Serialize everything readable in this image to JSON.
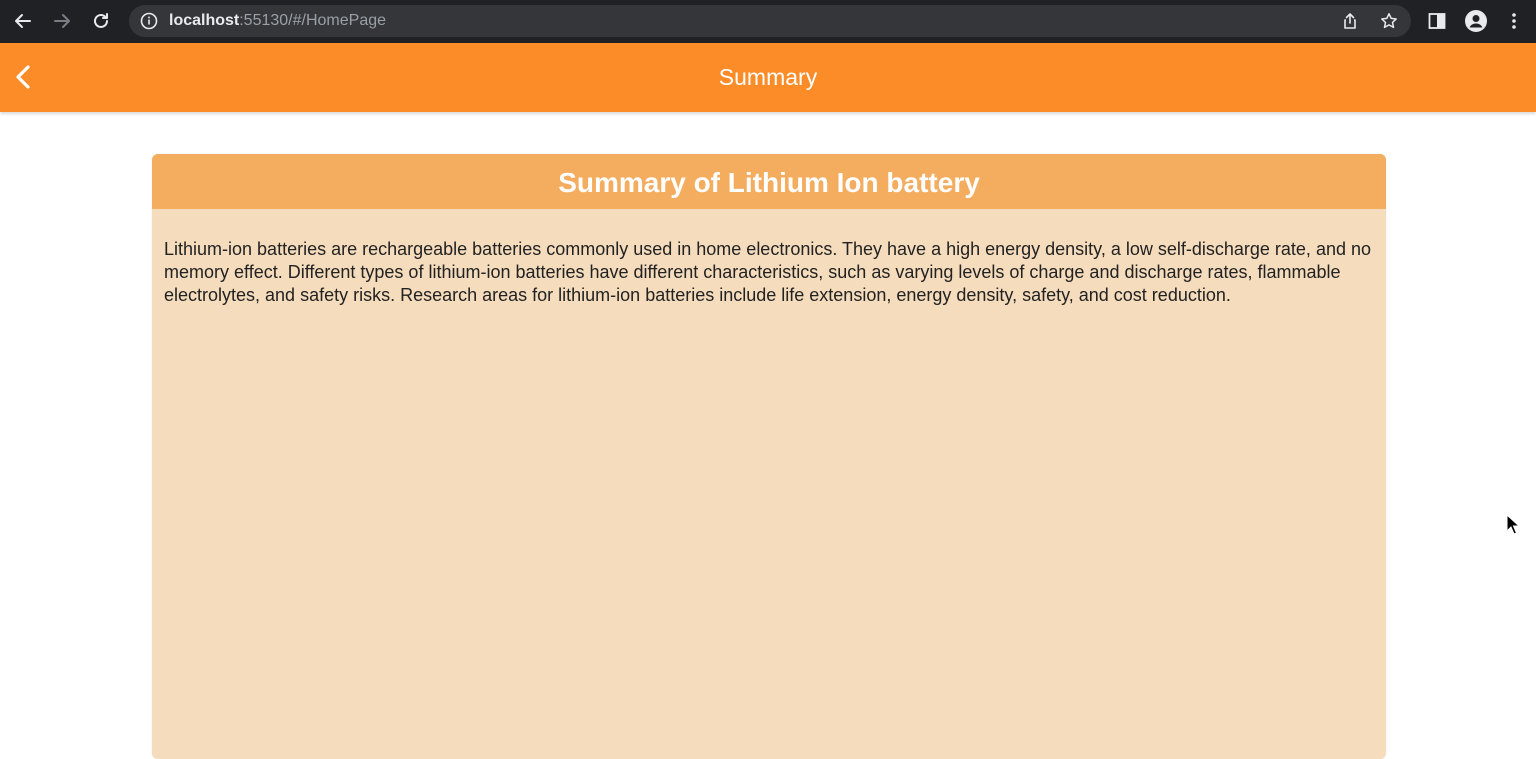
{
  "browser": {
    "url_host": "localhost",
    "url_rest": ":55130/#/HomePage"
  },
  "appbar": {
    "title": "Summary"
  },
  "card": {
    "title": "Summary of Lithium Ion battery",
    "body": " Lithium-ion batteries are rechargeable batteries commonly used in home electronics. They have a high energy density, a low self-discharge rate, and no memory effect. Different types of lithium-ion batteries have different characteristics, such as varying levels of charge and discharge rates, flammable electrolytes, and safety risks. Research areas for lithium-ion batteries include life extension, energy density, safety, and cost reduction."
  },
  "colors": {
    "chrome": "#202124",
    "appbar": "#fb8c28",
    "card_header": "#f4ad5f",
    "card_body": "#f5dcbd"
  },
  "icons": {
    "back": "arrow-left-icon",
    "forward": "arrow-right-icon",
    "reload": "reload-icon",
    "info": "info-icon",
    "share": "share-icon",
    "bookmark": "star-icon",
    "side_panel": "side-panel-icon",
    "profile": "profile-icon",
    "menu": "kebab-menu-icon",
    "appbar_back": "chevron-left-icon"
  }
}
